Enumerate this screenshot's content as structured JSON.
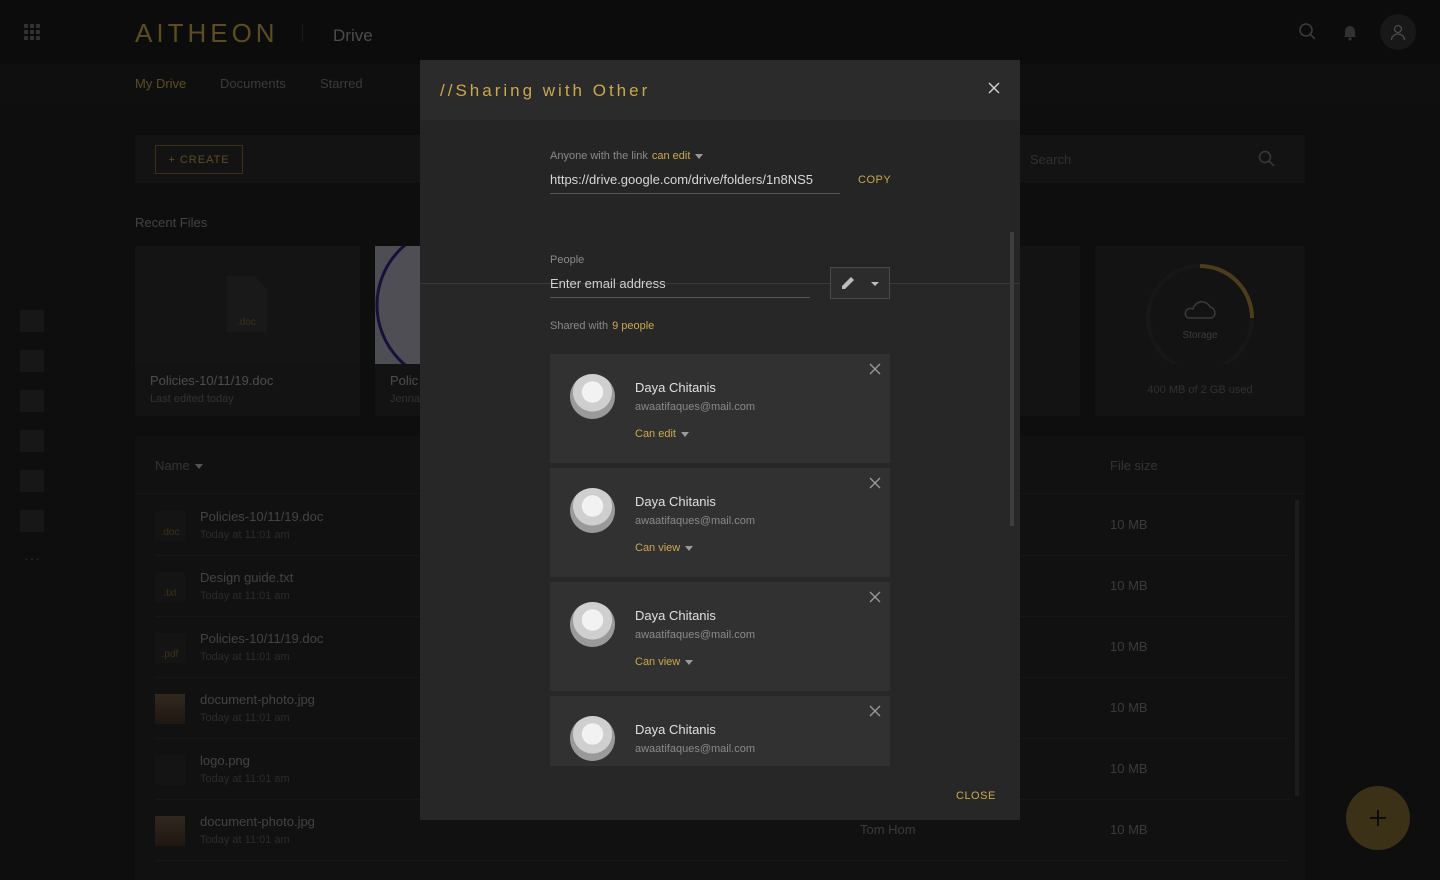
{
  "app": {
    "logo": "AITHEON",
    "name": "Drive"
  },
  "subnav": {
    "tabs": [
      {
        "label": "My Drive",
        "active": true
      },
      {
        "label": "Documents",
        "active": false
      },
      {
        "label": "Starred",
        "active": false
      }
    ]
  },
  "toolbar": {
    "create_label": "+ CREATE",
    "search_placeholder": "Search"
  },
  "recent": {
    "heading": "Recent Files",
    "cards": [
      {
        "title": "Policies-10/11/19.doc",
        "sub": "Last edited today",
        "ext": ".doc"
      },
      {
        "title": "Polic",
        "sub": "Jenna"
      }
    ],
    "storage": {
      "label": "Storage",
      "usage": "400 MB of 2 GB used",
      "fraction_used": 0.2
    }
  },
  "table": {
    "headers": {
      "name": "Name",
      "size": "File size"
    },
    "rows": [
      {
        "name": "Policies-10/11/19.doc",
        "date": "Today at 11:01 am",
        "ext": ".doc",
        "owner": "",
        "size": "10 MB"
      },
      {
        "name": "Design guide.txt",
        "date": "Today at 11:01 am",
        "ext": ".txt",
        "owner": "",
        "size": "10 MB"
      },
      {
        "name": "Policies-10/11/19.doc",
        "date": "Today at 11:01 am",
        "ext": ".pdf",
        "owner": "",
        "size": "10 MB"
      },
      {
        "name": "document-photo.jpg",
        "date": "Today at 11:01 am",
        "ext": "",
        "owner": "",
        "size": "10 MB"
      },
      {
        "name": "logo.png",
        "date": "Today at 11:01 am",
        "ext": "",
        "owner": "",
        "size": "10 MB"
      },
      {
        "name": "document-photo.jpg",
        "date": "Today at 11:01 am",
        "ext": "",
        "owner": "Tom Hom",
        "size": "10 MB"
      }
    ]
  },
  "modal": {
    "title": "//Sharing with Other",
    "link_caption": "Anyone with the link",
    "link_permission": "can edit",
    "link_url": "https://drive.google.com/drive/folders/1n8NS5",
    "copy_label": "COPY",
    "people_label": "People",
    "email_placeholder": "Enter email address",
    "shared_with_label": "Shared with",
    "shared_count": "9 people",
    "people": [
      {
        "name": "Daya Chitanis",
        "email": "awaatifaques@mail.com",
        "permission": "Can edit"
      },
      {
        "name": "Daya Chitanis",
        "email": "awaatifaques@mail.com",
        "permission": "Can view"
      },
      {
        "name": "Daya Chitanis",
        "email": "awaatifaques@mail.com",
        "permission": "Can view"
      },
      {
        "name": "Daya Chitanis",
        "email": "awaatifaques@mail.com",
        "permission": ""
      }
    ],
    "close_label": "CLOSE"
  },
  "colors": {
    "accent": "#c9a94f",
    "background": "#1a1a1a",
    "modal": "#272727"
  }
}
